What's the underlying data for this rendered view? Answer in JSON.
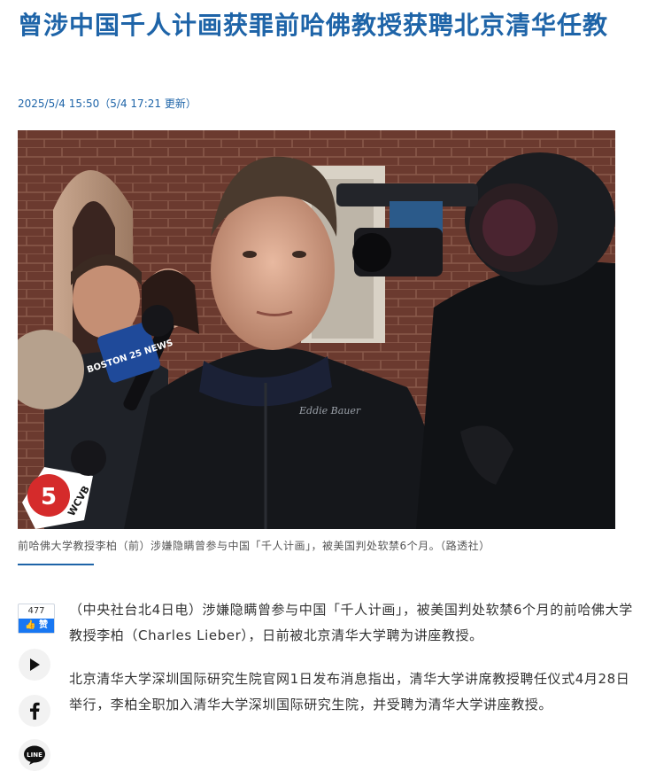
{
  "headline": "曾涉中国千人计画获罪前哈佛教授获聘北京清华任教",
  "timestamp": "2025/5/4 15:50（5/4 17:21 更新）",
  "photo": {
    "mic_1": "BOSTON 25 NEWS",
    "mic_2": "WCVB",
    "mic_2_digit": "5",
    "jacket_brand": "Eddie Bauer"
  },
  "caption": "前哈佛大学教授李柏（前）涉嫌隐瞒曾参与中国「千人计画」，被美国判处软禁6个月。（路透社）",
  "social": {
    "like_count": "477",
    "like_label": "👍 赞",
    "line_label": "LINE"
  },
  "article": {
    "paragraphs": [
      "（中央社台北4日电）涉嫌隐瞒曾参与中国「千人计画」，被美国判处软禁6个月的前哈佛大学教授李柏（Charles Lieber），日前被北京清华大学聘为讲座教授。",
      "北京清华大学深圳国际研究生院官网1日发布消息指出，清华大学讲席教授聘任仪式4月28日举行，李柏全职加入清华大学深圳国际研究生院，并受聘为清华大学讲座教授。"
    ]
  }
}
